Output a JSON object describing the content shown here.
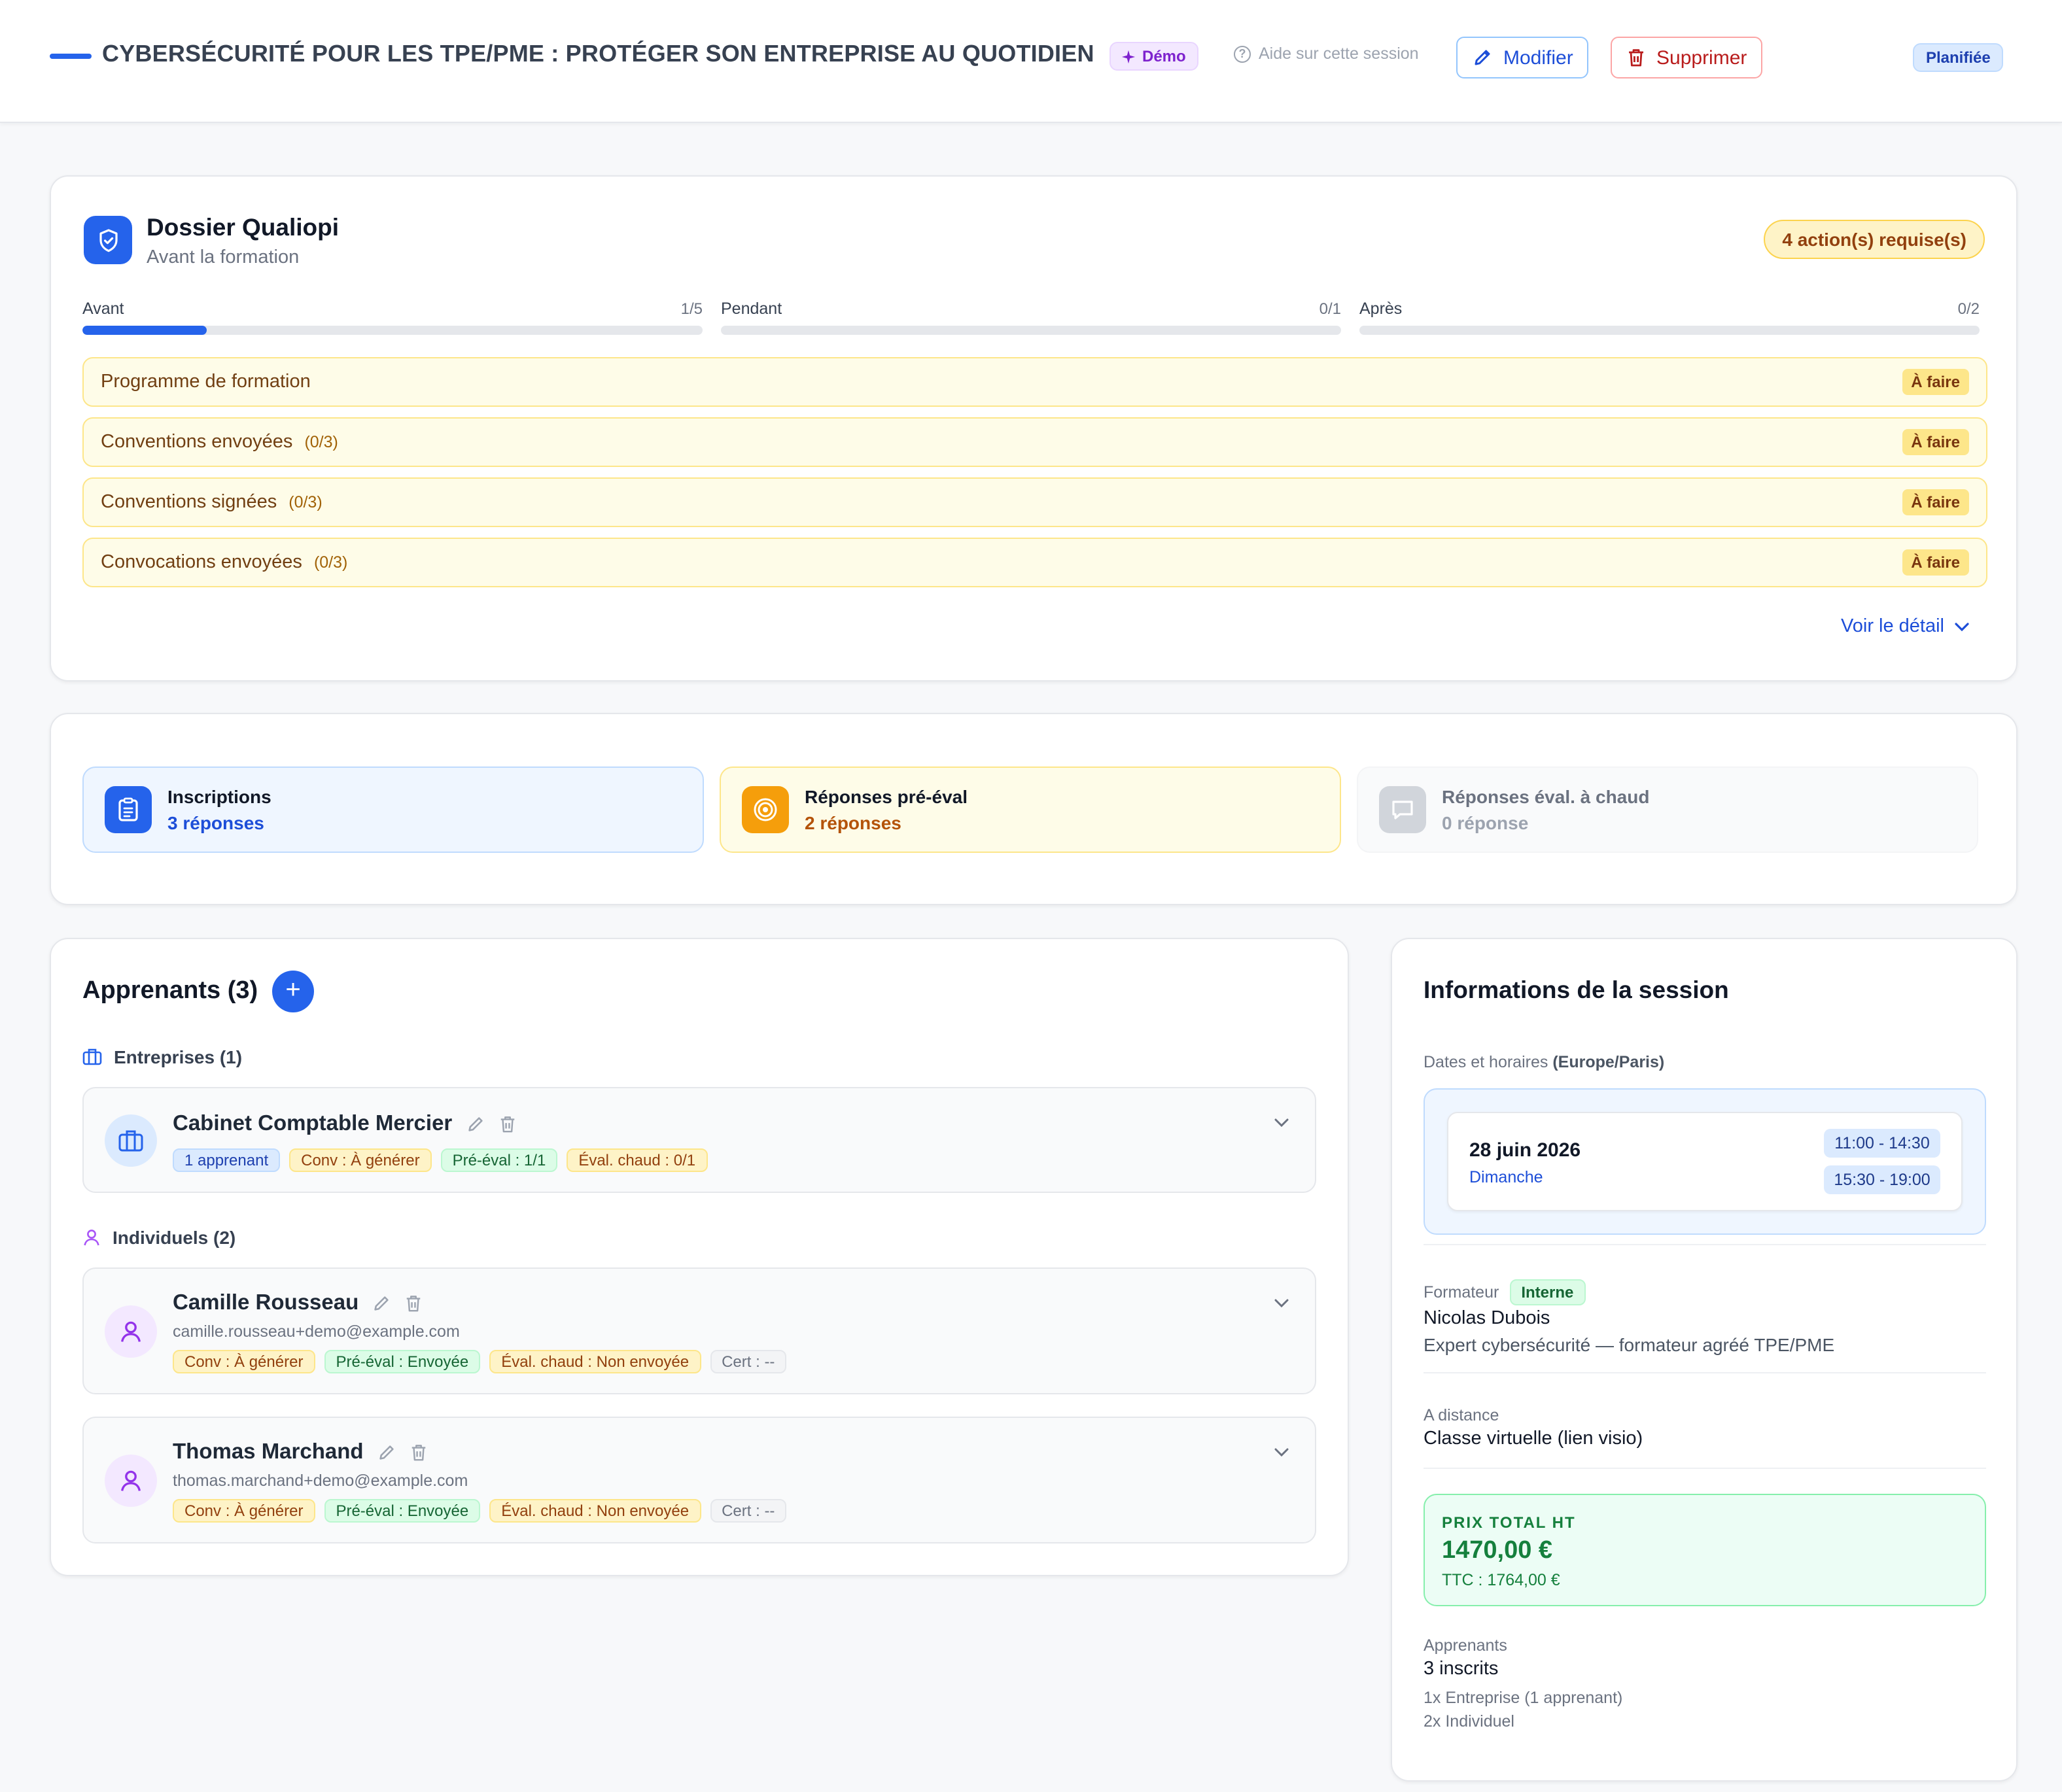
{
  "header": {
    "title": "CYBERSÉCURITÉ POUR LES TPE/PME : PROTÉGER SON ENTREPRISE AU QUOTIDIEN",
    "demo_badge": "Démo",
    "help_link": "Aide sur cette session",
    "edit_label": "Modifier",
    "delete_label": "Supprimer",
    "status": "Planifiée",
    "accent_color": "#2563eb"
  },
  "qualiopi": {
    "title": "Dossier Qualiopi",
    "subtitle": "Avant la formation",
    "actions_badge": "4 action(s) requise(s)",
    "phases": [
      {
        "label": "Avant",
        "count": "1/5",
        "progress": 0.2
      },
      {
        "label": "Pendant",
        "count": "0/1",
        "progress": 0
      },
      {
        "label": "Après",
        "count": "0/2",
        "progress": 0
      }
    ],
    "tasks": [
      {
        "name": "Programme de formation",
        "count": "",
        "status": "À faire"
      },
      {
        "name": "Conventions envoyées",
        "count": "(0/3)",
        "status": "À faire"
      },
      {
        "name": "Conventions signées",
        "count": "(0/3)",
        "status": "À faire"
      },
      {
        "name": "Convocations envoyées",
        "count": "(0/3)",
        "status": "À faire"
      }
    ],
    "detail_link": "Voir le détail"
  },
  "forms": {
    "registrations": {
      "title": "Inscriptions",
      "value": "3 réponses"
    },
    "pre_eval": {
      "title": "Réponses pré-éval",
      "value": "2 réponses"
    },
    "hot_eval": {
      "title": "Réponses éval. à chaud",
      "value": "0 réponse"
    }
  },
  "learners": {
    "title": "Apprenants (3)",
    "companies_label": "Entreprises (1)",
    "individuals_label": "Individuels (2)",
    "company": {
      "name": "Cabinet Comptable Mercier",
      "tags": [
        "1 apprenant",
        "Conv : À générer",
        "Pré-éval : 1/1",
        "Éval. chaud : 0/1"
      ]
    },
    "individuals": [
      {
        "name": "Camille Rousseau",
        "email": "camille.rousseau+demo@example.com",
        "tags": [
          "Conv : À générer",
          "Pré-éval : Envoyée",
          "Éval. chaud : Non envoyée",
          "Cert : --"
        ]
      },
      {
        "name": "Thomas Marchand",
        "email": "thomas.marchand+demo@example.com",
        "tags": [
          "Conv : À générer",
          "Pré-éval : Envoyée",
          "Éval. chaud : Non envoyée",
          "Cert : --"
        ]
      }
    ]
  },
  "session_info": {
    "title": "Informations de la session",
    "dates_label": "Dates et horaires",
    "timezone": "(Europe/Paris)",
    "date": "28 juin 2026",
    "day": "Dimanche",
    "slots": [
      "11:00 - 14:30",
      "15:30 - 19:00"
    ],
    "trainer_label": "Formateur",
    "trainer_badge": "Interne",
    "trainer_name": "Nicolas Dubois",
    "trainer_desc": "Expert cybersécurité — formateur agréé TPE/PME",
    "mode_label": "A distance",
    "mode_value": "Classe virtuelle (lien visio)",
    "price_label": "PRIX TOTAL HT",
    "price_value": "1470,00 €",
    "price_ttc": "TTC : 1764,00 €",
    "learners_label": "Apprenants",
    "learners_value": "3 inscrits",
    "learners_detail_1": "1x Entreprise (1 apprenant)",
    "learners_detail_2": "2x Individuel"
  }
}
